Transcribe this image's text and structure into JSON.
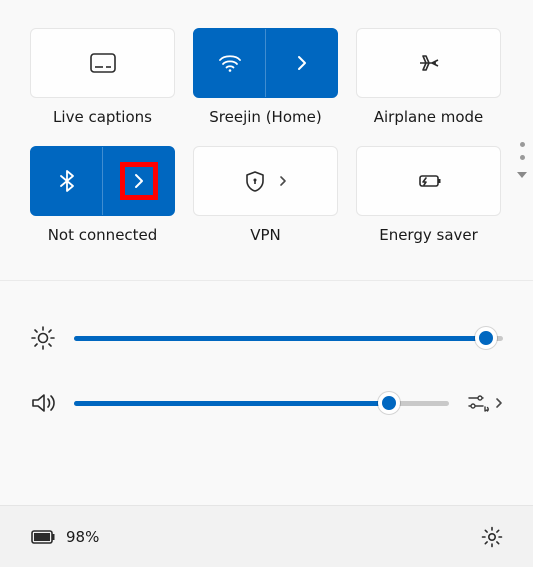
{
  "tiles": {
    "live_captions": {
      "label": "Live captions",
      "active": false
    },
    "wifi": {
      "label": "Sreejin (Home)",
      "active": true
    },
    "airplane": {
      "label": "Airplane mode",
      "active": false
    },
    "bluetooth": {
      "label": "Not connected",
      "active": true,
      "highlighted_expand": true
    },
    "vpn": {
      "label": "VPN",
      "active": false
    },
    "energy": {
      "label": "Energy saver",
      "active": false
    }
  },
  "sliders": {
    "brightness": {
      "percent": 96
    },
    "volume": {
      "percent": 84
    }
  },
  "footer": {
    "battery_text": "98%"
  },
  "colors": {
    "accent": "#0067c0",
    "highlight": "#ff0000"
  }
}
